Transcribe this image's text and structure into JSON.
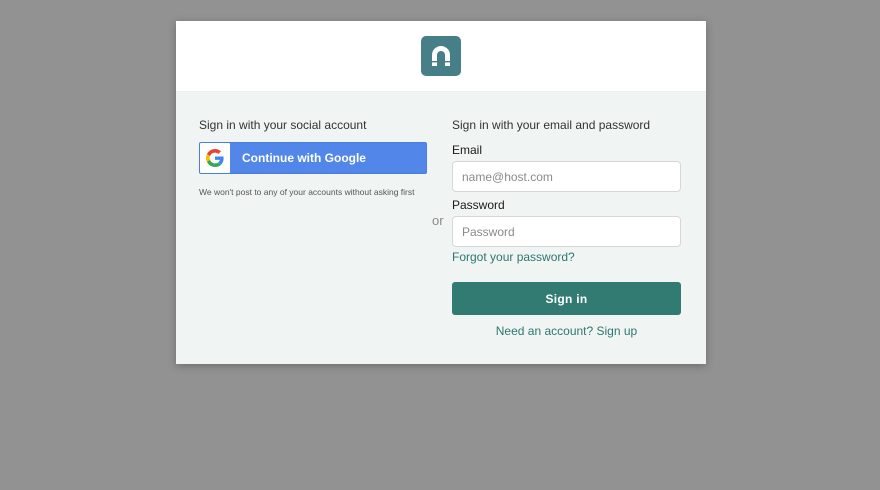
{
  "logo": {
    "icon": "magnet-icon",
    "color": "#477f89"
  },
  "social": {
    "title": "Sign in with your social account",
    "google_button_label": "Continue with Google",
    "google_icon": "google-icon",
    "disclaimer": "We won't post to any of your accounts without asking first"
  },
  "divider": {
    "label": "or"
  },
  "email_form": {
    "title": "Sign in with your email and password",
    "email_label": "Email",
    "email_placeholder": "name@host.com",
    "email_value": "",
    "password_label": "Password",
    "password_placeholder": "Password",
    "password_value": "",
    "forgot_link": "Forgot your password?",
    "submit_label": "Sign in",
    "signup_prompt": "Need an account?",
    "signup_link": "Sign up"
  },
  "colors": {
    "backdrop": "#929292",
    "panel": "#f0f5f3",
    "accent": "#327b72",
    "google_blue": "#5287e9"
  }
}
